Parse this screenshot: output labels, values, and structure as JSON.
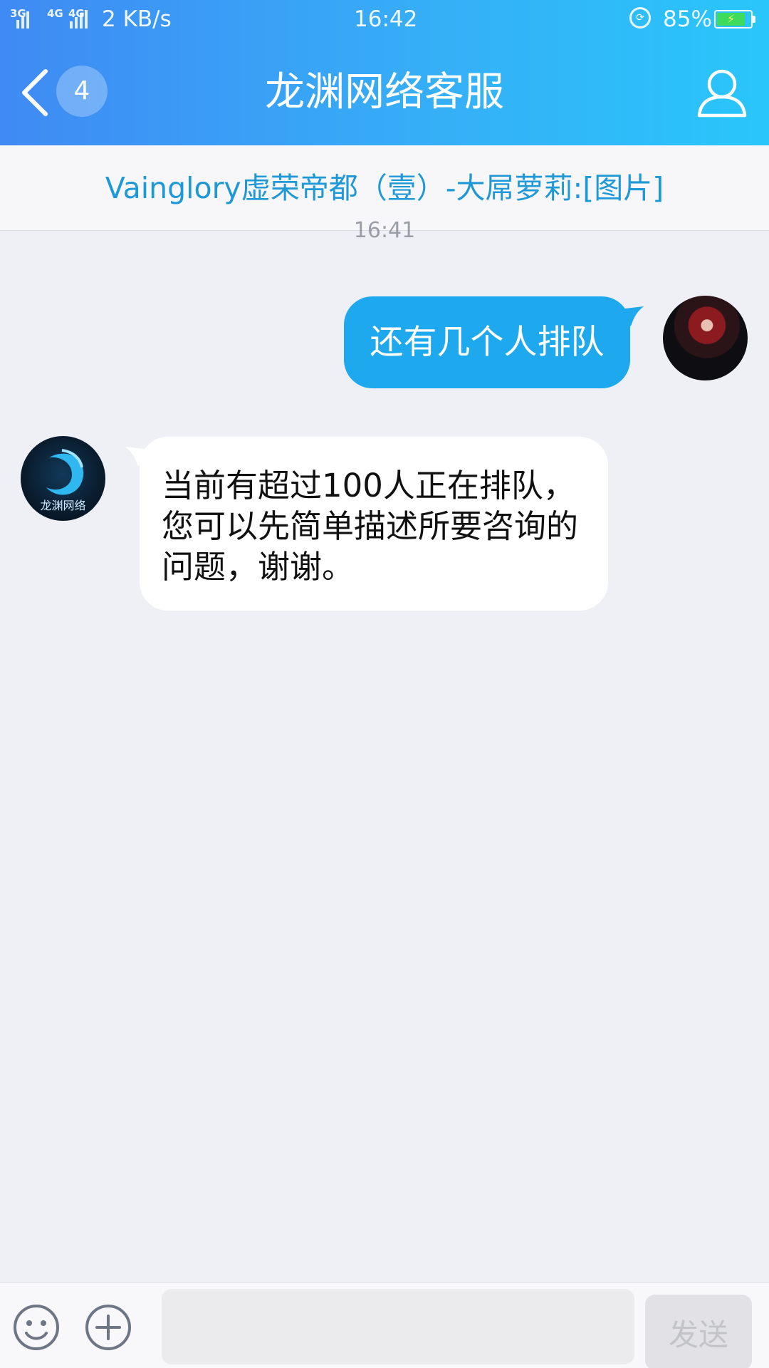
{
  "status_bar": {
    "net_1": "3G",
    "net_2": "4G",
    "net_3": "4G",
    "speed": "2 KB/s",
    "time": "16:42",
    "battery": "85%",
    "battery_level": 0.85
  },
  "header": {
    "back_label": "back",
    "unread_count": "4",
    "title": "龙渊网络客服",
    "accent": "#36aef7"
  },
  "notice": {
    "text": "Vainglory虚荣帝都（壹）-大屌萝莉:[图片]"
  },
  "chat": {
    "timestamp": "16:41",
    "messages": [
      {
        "side": "right",
        "text": "还有几个人排队"
      },
      {
        "side": "left",
        "text": "当前有超过100人正在排队，您可以先简单描述所要咨询的问题，谢谢。"
      }
    ],
    "agent_brand": "龙渊网络",
    "outgoing_bubble_color": "#1ea9ee"
  },
  "input_bar": {
    "placeholder": "",
    "send_label": "发送"
  }
}
